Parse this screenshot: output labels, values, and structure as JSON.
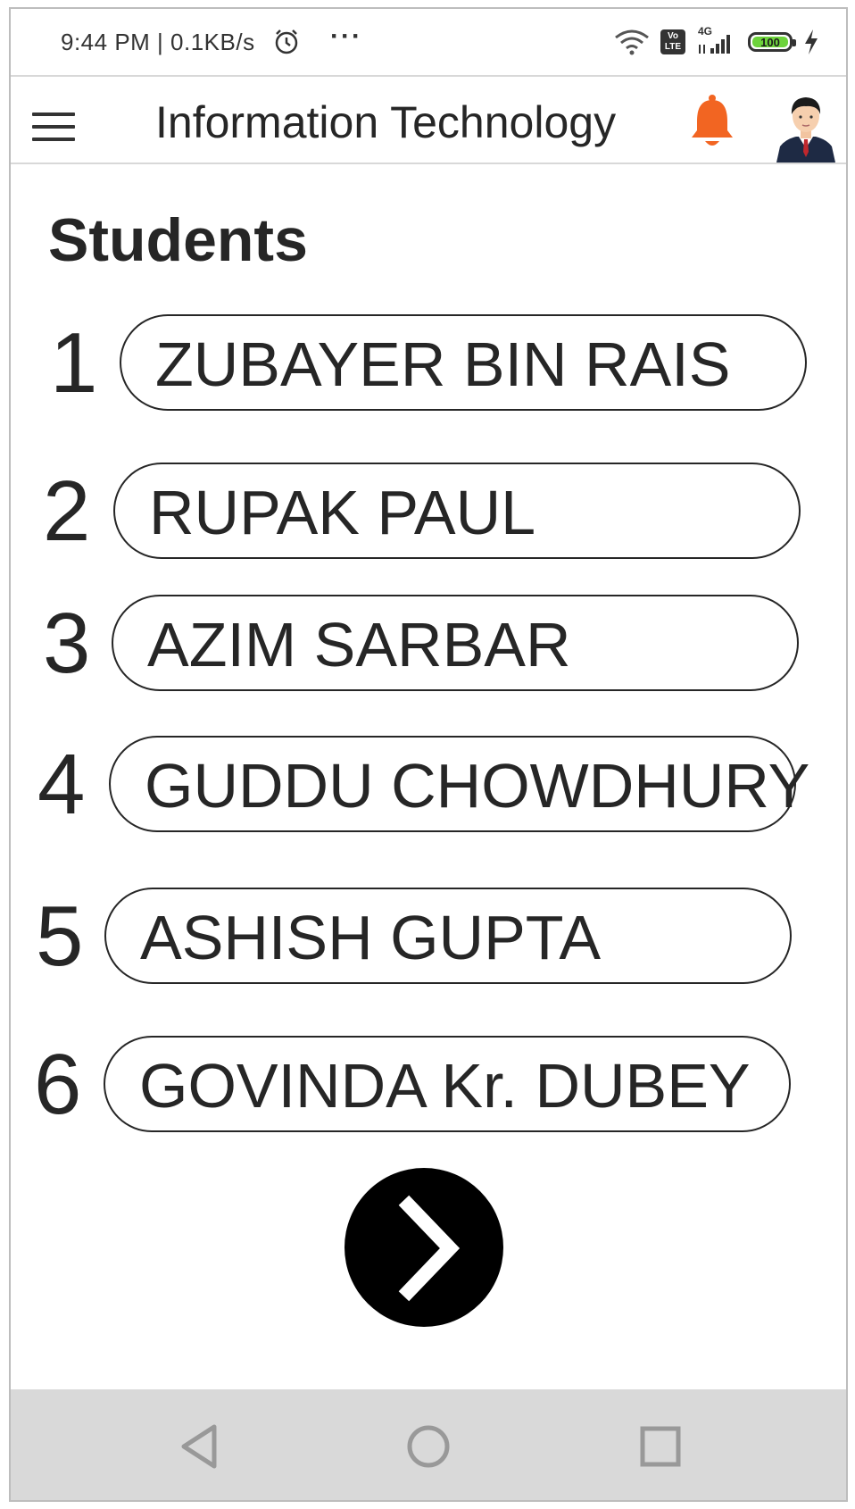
{
  "status_bar": {
    "time": "9:44 PM | 0.1KB/s",
    "more_indicator": "···",
    "volte_label": "Vo LTE",
    "network_type": "4G",
    "battery_level": "100",
    "icons": [
      "alarm-icon",
      "wifi-icon",
      "volte-icon",
      "signal-icon",
      "battery-icon",
      "charging-icon"
    ]
  },
  "app_bar": {
    "title": "Information Technology",
    "icons": [
      "menu-icon",
      "notification-bell-icon",
      "profile-avatar"
    ],
    "bell_color": "#f26522"
  },
  "main": {
    "heading": "Students",
    "students": [
      {
        "number": "1",
        "name": "ZUBAYER BIN RAIS"
      },
      {
        "number": "2",
        "name": "RUPAK PAUL"
      },
      {
        "number": "3",
        "name": "AZIM SARBAR"
      },
      {
        "number": "4",
        "name": "GUDDU CHOWDHURY"
      },
      {
        "number": "5",
        "name": "ASHISH GUPTA"
      },
      {
        "number": "6",
        "name": "GOVINDA Kr. DUBEY"
      }
    ],
    "next_button_icon": "chevron-right-icon"
  },
  "nav_bar": {
    "buttons": [
      "back-icon",
      "home-icon",
      "recents-icon"
    ]
  },
  "colors": {
    "text": "#262626",
    "accent": "#f26522",
    "battery": "#6dd33b",
    "nav_background": "#d9d9d9"
  }
}
